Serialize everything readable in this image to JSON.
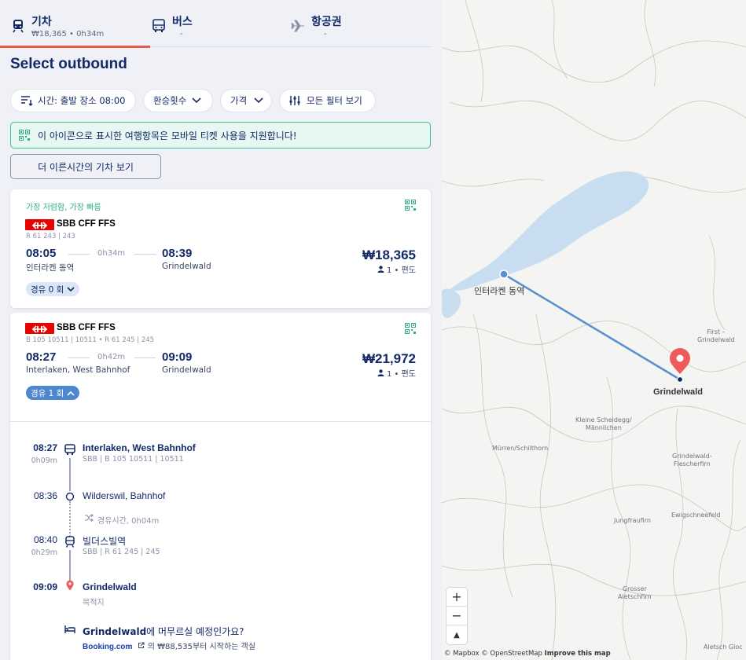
{
  "tabs": [
    {
      "label": "기차",
      "sub": "₩18,365 • 0h34m",
      "active": true
    },
    {
      "label": "버스",
      "sub": "-"
    },
    {
      "label": "항공권",
      "sub": "-"
    }
  ],
  "page_title": "Select outbound",
  "filters": {
    "time": "시간: 출발 장소 08:00",
    "transfers": "환승횟수",
    "price": "가격",
    "all_filters": "모든 필터 보기"
  },
  "mobile_banner": "이 아이콘으로 표시한 여행항목은 모바일 티켓 사용을 지원합니다!",
  "earlier_button": "더 이른시간의 기차 보기",
  "results": [
    {
      "badges": "가장 저렴함,  가장 빠름",
      "operator": "SBB CFF FFS",
      "code": "R 61 243 | 243",
      "dep_time": "08:05",
      "dep_station": "인터라켄 동역",
      "duration": "0h34m",
      "arr_time": "08:39",
      "arr_station": "Grindelwald",
      "price": "₩18,365",
      "passengers": "1 • 편도",
      "stops": "경유 0 회"
    },
    {
      "operator": "SBB CFF FFS",
      "code": "B 105 10511 | 10511 • R 61 245 | 245",
      "dep_time": "08:27",
      "dep_station": "Interlaken, West Bahnhof",
      "duration": "0h42m",
      "arr_time": "09:09",
      "arr_station": "Grindelwald",
      "price": "₩21,972",
      "passengers": "1 • 편도",
      "stops": "경유 1 회"
    }
  ],
  "journey": {
    "seg1_time": "08:27",
    "seg1_dur": "0h09m",
    "seg1_name": "Interlaken, West Bahnhof",
    "seg1_code": "SBB | B 105 10511 | 10511",
    "stop_time": "08:36",
    "stop_name": "Wilderswil, Bahnhof",
    "transfer": "경유시간, 0h04m",
    "seg2_time": "08:40",
    "seg2_dur": "0h29m",
    "seg2_name": "빌더스빌역",
    "seg2_code": "SBB | R 61 245 | 245",
    "arr_time": "09:09",
    "arr_name": "Grindelwald",
    "arr_sub": "목적지"
  },
  "hotel": {
    "city": "Grindelwald",
    "question": "에 머무르실 예정인가요?",
    "brand": "Booking.com",
    "offer": "의 ₩88,535부터 시작하는 객실"
  },
  "map": {
    "origin_label": "인터라켄 동역",
    "dest_label": "Grindelwald",
    "places": [
      {
        "name": "First –\nGrindelwald"
      },
      {
        "name": "Kleine Scheidegg/\nMännlichen"
      },
      {
        "name": "Mürren/Schilthorn"
      },
      {
        "name": "Grindelwald-\nFlescherfirn"
      },
      {
        "name": "Jungfraufirn"
      },
      {
        "name": "Ewigschneefeld"
      },
      {
        "name": "Grosser\nAletschfirn"
      },
      {
        "name": "Aletsch Gloc"
      }
    ],
    "zoom_in": "+",
    "zoom_out": "−",
    "compass": "▲",
    "attribution": {
      "mapbox": "© Mapbox",
      "osm": "© OpenStreetMap",
      "improve": "Improve this map"
    },
    "colors": {
      "route": "#5a8fd0",
      "pin": "#ef5b5b",
      "lake": "#c9ddf0"
    }
  }
}
